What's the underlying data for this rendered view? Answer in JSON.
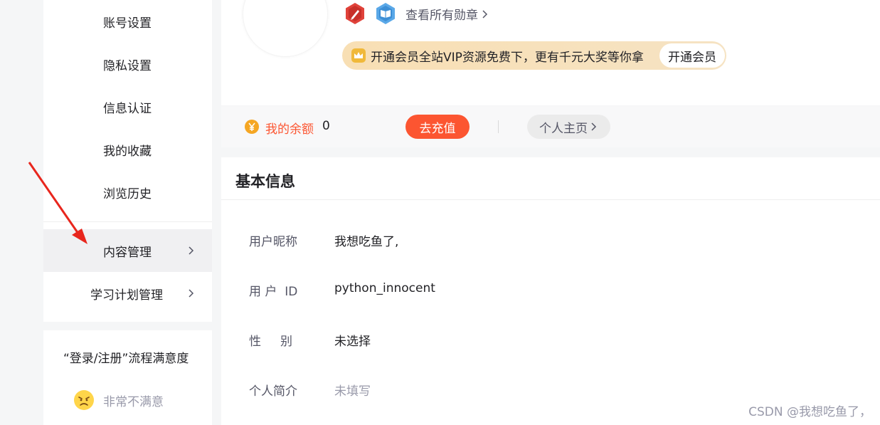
{
  "sidebar": {
    "items": [
      {
        "label": "账号设置"
      },
      {
        "label": "隐私设置"
      },
      {
        "label": "信息认证"
      },
      {
        "label": "我的收藏"
      },
      {
        "label": "浏览历史"
      }
    ],
    "content_manage": {
      "label": "内容管理"
    },
    "study_plan": {
      "label": "学习计划管理"
    }
  },
  "survey": {
    "title": "“登录/注册”流程满意度",
    "option": "非常不满意"
  },
  "profile": {
    "badges_link": "查看所有勋章",
    "vip_text": "开通会员全站VIP资源免费下，更有千元大奖等你拿",
    "vip_button": "开通会员"
  },
  "balance": {
    "label": "我的余额",
    "value": "0",
    "recharge": "去充值",
    "homepage": "个人主页"
  },
  "basic_info": {
    "title": "基本信息",
    "rows": [
      {
        "key": "用户昵称",
        "value": "我想吃鱼了,"
      },
      {
        "key": "用 户  ID",
        "value": "python_innocent"
      },
      {
        "key": "性     别",
        "value": "未选择"
      },
      {
        "key": "个人简介",
        "value": "未填写"
      }
    ]
  },
  "watermark": "CSDN @我想吃鱼了，",
  "colors": {
    "accent": "#fc5531",
    "annotation_arrow": "#e8261d"
  }
}
